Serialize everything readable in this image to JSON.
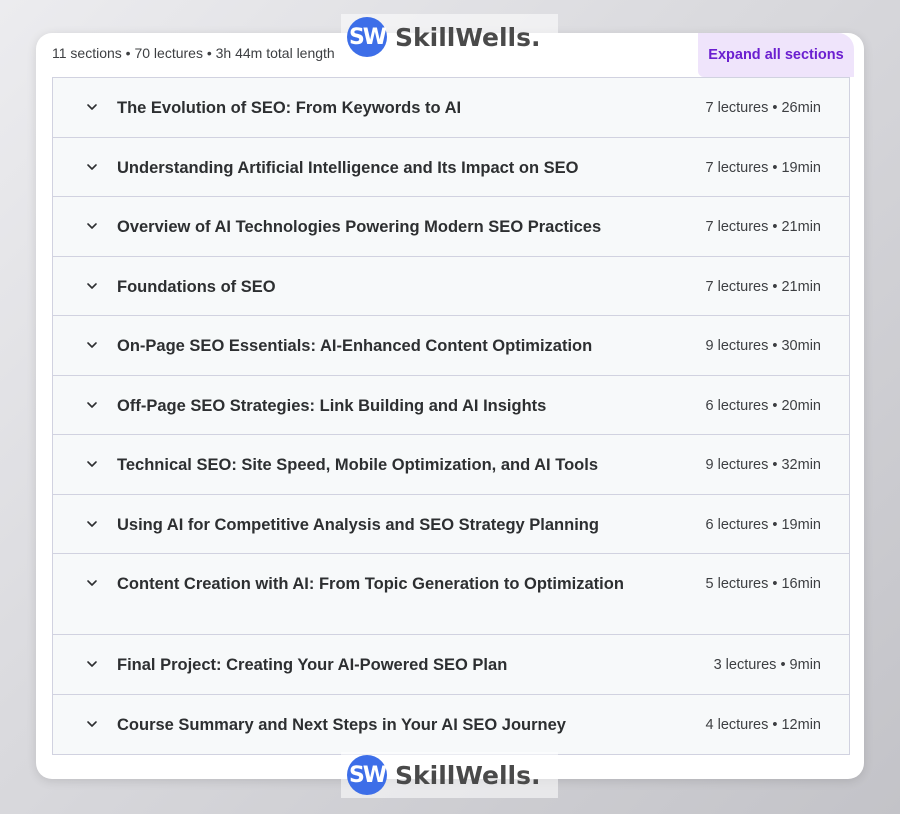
{
  "summary": "11 sections • 70 lectures • 3h 44m total length",
  "expand_label": "Expand all sections",
  "watermark": {
    "logo": "SW",
    "text": "SkillWells."
  },
  "sections": [
    {
      "title": "The Evolution of SEO: From Keywords to AI",
      "meta": "7 lectures • 26min"
    },
    {
      "title": "Understanding Artificial Intelligence and Its Impact on SEO",
      "meta": "7 lectures • 19min"
    },
    {
      "title": "Overview of AI Technologies Powering Modern SEO Practices",
      "meta": "7 lectures • 21min"
    },
    {
      "title": "Foundations of SEO",
      "meta": "7 lectures • 21min"
    },
    {
      "title": "On-Page SEO Essentials: AI-Enhanced Content Optimization",
      "meta": "9 lectures • 30min"
    },
    {
      "title": "Off-Page SEO Strategies: Link Building and AI Insights",
      "meta": "6 lectures • 20min"
    },
    {
      "title": "Technical SEO: Site Speed, Mobile Optimization, and AI Tools",
      "meta": "9 lectures • 32min"
    },
    {
      "title": "Using AI for Competitive Analysis and SEO Strategy Planning",
      "meta": "6 lectures • 19min"
    },
    {
      "title": "Content Creation with AI: From Topic Generation to Optimization",
      "meta": "5 lectures • 16min"
    },
    {
      "title": "Final Project: Creating Your AI-Powered SEO Plan",
      "meta": "3 lectures • 9min"
    },
    {
      "title": "Course Summary and Next Steps in Your AI SEO Journey",
      "meta": "4 lectures • 12min"
    }
  ]
}
